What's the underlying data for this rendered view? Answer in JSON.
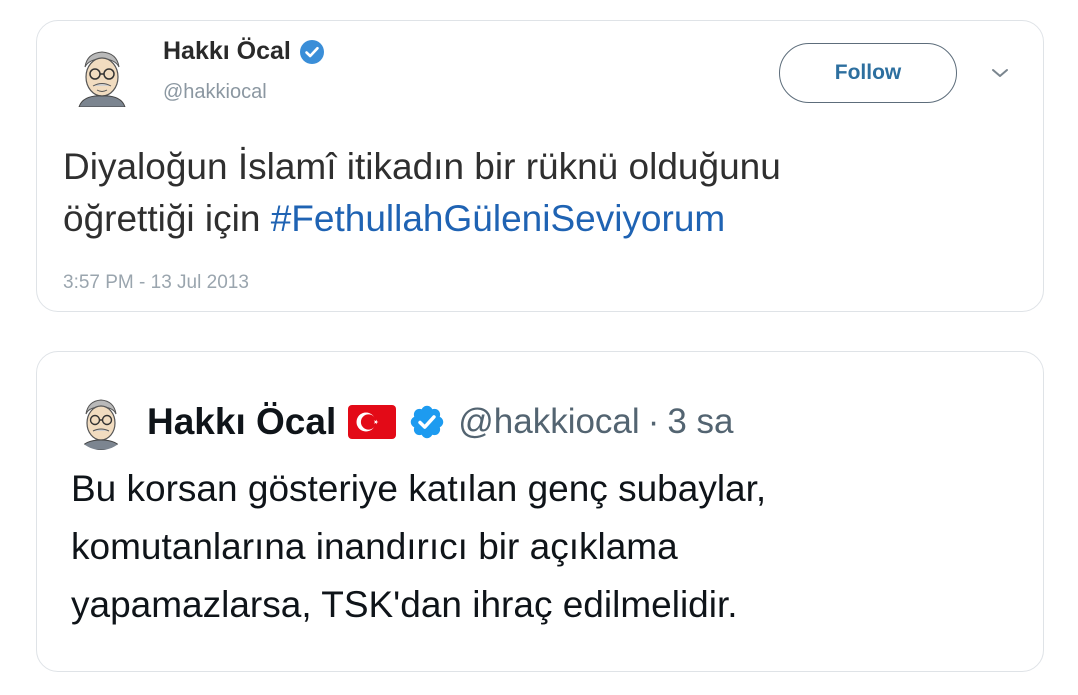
{
  "tweet1": {
    "author_name": "Hakkı Öcal",
    "handle": "@hakkiocal",
    "follow_label": "Follow",
    "text_line1": "Diyaloğun İslamî itikadın bir rüknü olduğunu",
    "text_line2_prefix": "öğrettiği için ",
    "hashtag": "#FethullahGüleniSeviyorum",
    "timestamp": "3:57 PM - 13 Jul 2013",
    "icons": {
      "verified": "verified-badge-icon",
      "more": "chevron-down-icon",
      "avatar": "avatar-caricature"
    }
  },
  "tweet2": {
    "author_name": "Hakkı Öcal",
    "handle": "@hakkiocal",
    "separator": "·",
    "time_ago": "3 sa",
    "text_line1": "Bu korsan gösteriye katılan genç subaylar,",
    "text_line2": "komutanlarına inandırıcı bir açıklama",
    "text_line3": "yapamazlarsa, TSK'dan ihraç edilmelidir.",
    "icons": {
      "flag": "turkey-flag-icon",
      "verified": "verified-badge-icon",
      "avatar": "avatar-caricature"
    }
  },
  "colors": {
    "verified_blue": "#1d9bf0",
    "hashtag_blue": "#1f63b3",
    "flag_red": "#e30a17",
    "card_border": "#dfe3e7"
  }
}
